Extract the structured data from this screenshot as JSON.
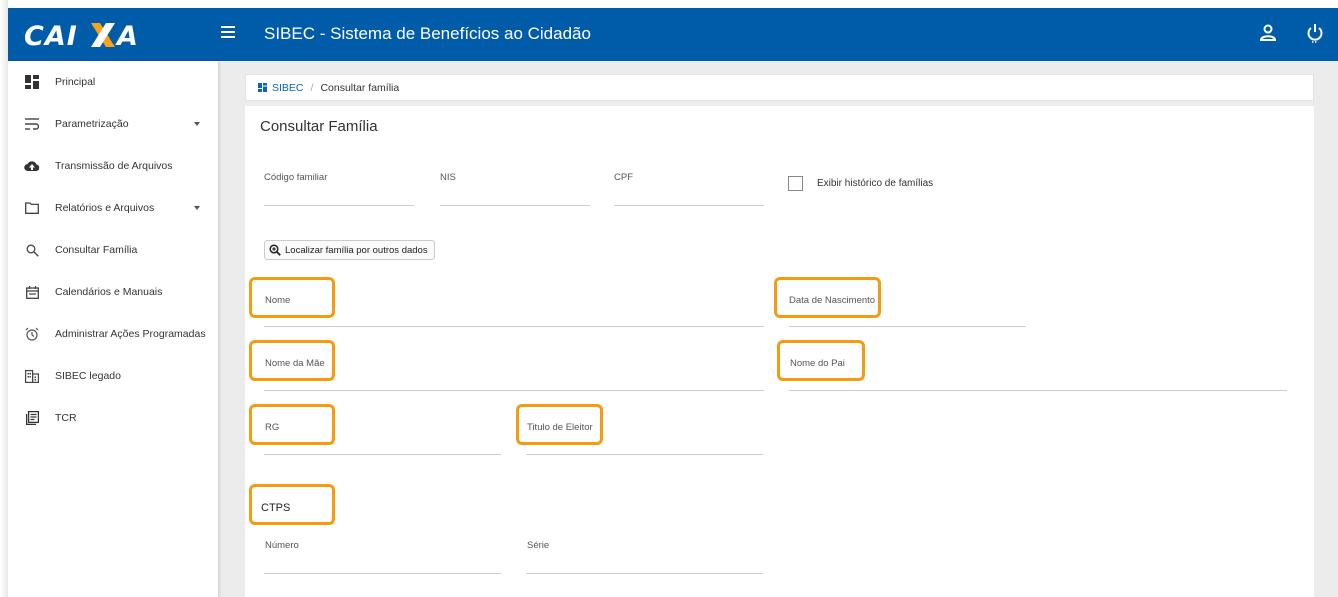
{
  "header": {
    "logo_text": "CAIXA",
    "app_title": "SIBEC - Sistema de Benefícios ao Cidadão",
    "bg_color": "#005ca9"
  },
  "sidebar": {
    "items": [
      {
        "label": "Principal",
        "icon": "dashboard-icon"
      },
      {
        "label": "Parametrização",
        "icon": "wrap-text-icon",
        "has_dropdown": true
      },
      {
        "label": "Transmissão de Arquivos",
        "icon": "cloud-upload-icon"
      },
      {
        "label": "Relatórios e Arquivos",
        "icon": "folder-icon",
        "has_dropdown": true
      },
      {
        "label": "Consultar Família",
        "icon": "search-icon"
      },
      {
        "label": "Calendários e Manuais",
        "icon": "calendar-icon"
      },
      {
        "label": "Administrar Ações Programadas",
        "icon": "alarm-clock-icon"
      },
      {
        "label": "SIBEC legado",
        "icon": "building-icon"
      },
      {
        "label": "TCR",
        "icon": "document-list-icon"
      }
    ]
  },
  "breadcrumb": {
    "root": "SIBEC",
    "separator": "/",
    "current": "Consultar família"
  },
  "main": {
    "title": "Consultar Família",
    "fields": {
      "codigo_familiar": {
        "label": "Código familiar",
        "value": ""
      },
      "nis": {
        "label": "NIS",
        "value": ""
      },
      "cpf": {
        "label": "CPF",
        "value": ""
      },
      "nome": {
        "label": "Nome",
        "value": ""
      },
      "data_nascimento": {
        "label": "Data de Nascimento",
        "value": ""
      },
      "nome_mae": {
        "label": "Nome da Mãe",
        "value": ""
      },
      "nome_pai": {
        "label": "Nome do Pai",
        "value": ""
      },
      "rg": {
        "label": "RG",
        "value": ""
      },
      "titulo_eleitor": {
        "label": "Titulo de Eleitor",
        "value": ""
      },
      "ctps_numero": {
        "label": "Número",
        "value": ""
      },
      "ctps_serie": {
        "label": "Série",
        "value": ""
      }
    },
    "history_checkbox": {
      "label": "Exibir histórico de famílias",
      "checked": false
    },
    "search_other_button": "Localizar família por outros dados",
    "ctps_section": "CTPS",
    "highlight_color": "#f39c12"
  }
}
